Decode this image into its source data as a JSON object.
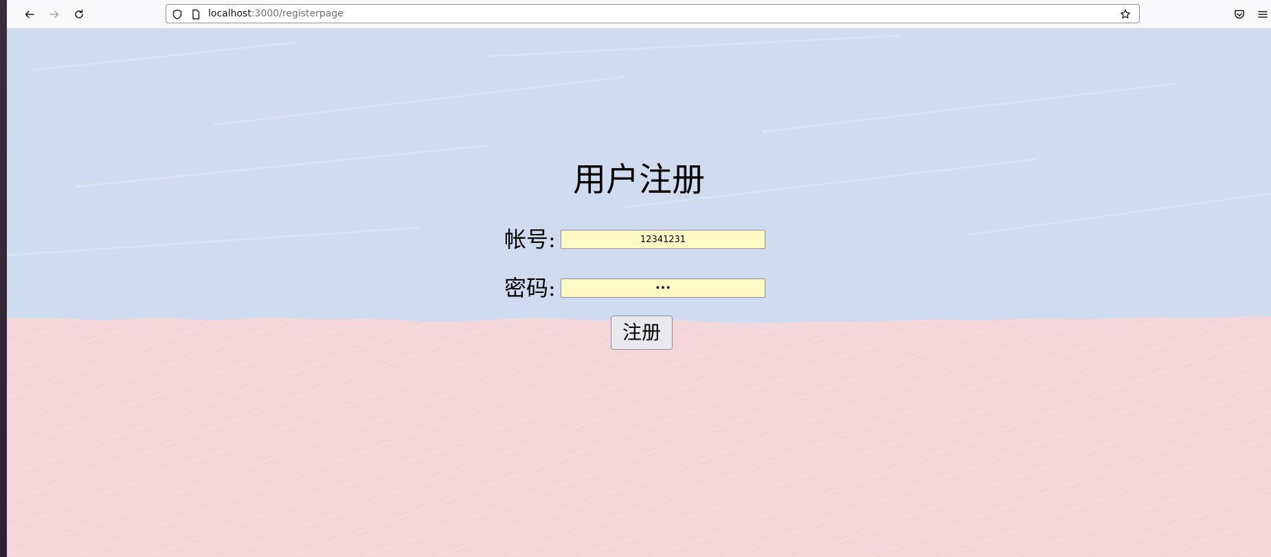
{
  "browser": {
    "url_host": "localhost",
    "url_path": ":3000/registerpage",
    "icons": {
      "back": "back-arrow-icon",
      "forward": "forward-arrow-icon",
      "reload": "reload-icon",
      "shield": "shield-icon",
      "page": "page-info-icon",
      "bookmark": "star-icon",
      "pocket": "pocket-icon",
      "menu": "hamburger-menu-icon"
    }
  },
  "page": {
    "title": "用户注册",
    "account_label": "帐号:",
    "account_value": "12341231",
    "password_label": "密码:",
    "password_value": "123",
    "register_button": "注册",
    "colors": {
      "background_top": "#cfdcf0",
      "background_bottom": "#f2d6d9",
      "input_fill": "#fffac4"
    }
  }
}
